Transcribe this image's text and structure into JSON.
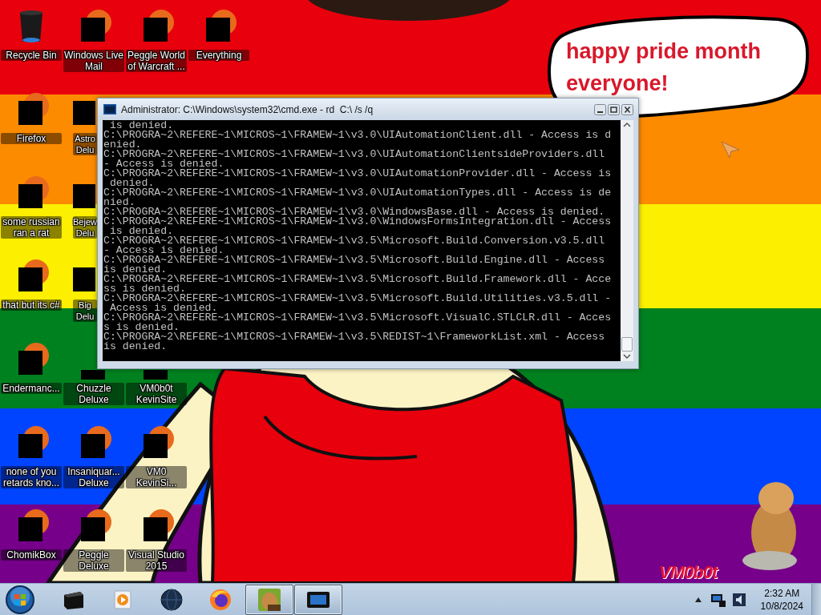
{
  "desktop_rows": [
    [
      {
        "label": "Recycle Bin",
        "kind": "bin"
      },
      {
        "label": "Windows Live Mail",
        "kind": "app"
      },
      {
        "label": "Peggle World of Warcraft ...",
        "kind": "app"
      },
      {
        "label": "Everything",
        "kind": "app"
      }
    ],
    [
      {
        "label": "Firefox",
        "kind": "app"
      },
      {
        "label": "Astro Delu",
        "kind": "partial"
      }
    ],
    [
      {
        "label": "some russian ran a rat",
        "kind": "app"
      },
      {
        "label": "Bejew Delu",
        "kind": "partial"
      }
    ],
    [
      {
        "label": "that but its c#",
        "kind": "app"
      },
      {
        "label": "Big Delu",
        "kind": "partial"
      }
    ],
    [
      {
        "label": "Endermanc...",
        "kind": "app"
      },
      {
        "label": "Chuzzle Deluxe",
        "kind": "clipped"
      },
      {
        "label": "VM0b0t KevinSite",
        "kind": "clipped"
      }
    ],
    [
      {
        "label": "none of you retards kno...",
        "kind": "app"
      },
      {
        "label": "Insaniquar... Deluxe",
        "kind": "app"
      },
      {
        "label": "VM0 KevinSi...",
        "kind": "app"
      }
    ],
    [
      {
        "label": "ChomikBox",
        "kind": "app"
      },
      {
        "label": "Peggle Deluxe",
        "kind": "app"
      },
      {
        "label": "Visual Studio 2015",
        "kind": "app"
      }
    ]
  ],
  "speech_bubble": {
    "text": "happy pride month everyone!"
  },
  "wallpaper_signature": "VM0b0t",
  "console_window": {
    "title": "Administrator: C:\\Windows\\system32\\cmd.exe - rd  C:\\ /s /q",
    "lines": [
      " is denied.",
      "C:\\PROGRA~2\\REFERE~1\\MICROS~1\\FRAMEW~1\\v3.0\\UIAutomationClient.dll - Access is d",
      "enied.",
      "C:\\PROGRA~2\\REFERE~1\\MICROS~1\\FRAMEW~1\\v3.0\\UIAutomationClientsideProviders.dll",
      "- Access is denied.",
      "C:\\PROGRA~2\\REFERE~1\\MICROS~1\\FRAMEW~1\\v3.0\\UIAutomationProvider.dll - Access is",
      " denied.",
      "C:\\PROGRA~2\\REFERE~1\\MICROS~1\\FRAMEW~1\\v3.0\\UIAutomationTypes.dll - Access is de",
      "nied.",
      "C:\\PROGRA~2\\REFERE~1\\MICROS~1\\FRAMEW~1\\v3.0\\WindowsBase.dll - Access is denied.",
      "C:\\PROGRA~2\\REFERE~1\\MICROS~1\\FRAMEW~1\\v3.0\\WindowsFormsIntegration.dll - Access",
      " is denied.",
      "C:\\PROGRA~2\\REFERE~1\\MICROS~1\\FRAMEW~1\\v3.5\\Microsoft.Build.Conversion.v3.5.dll",
      "- Access is denied.",
      "C:\\PROGRA~2\\REFERE~1\\MICROS~1\\FRAMEW~1\\v3.5\\Microsoft.Build.Engine.dll - Access",
      "is denied.",
      "C:\\PROGRA~2\\REFERE~1\\MICROS~1\\FRAMEW~1\\v3.5\\Microsoft.Build.Framework.dll - Acce",
      "ss is denied.",
      "C:\\PROGRA~2\\REFERE~1\\MICROS~1\\FRAMEW~1\\v3.5\\Microsoft.Build.Utilities.v3.5.dll -",
      " Access is denied.",
      "C:\\PROGRA~2\\REFERE~1\\MICROS~1\\FRAMEW~1\\v3.5\\Microsoft.VisualC.STLCLR.dll - Acces",
      "s is denied.",
      "C:\\PROGRA~2\\REFERE~1\\MICROS~1\\FRAMEW~1\\v3.5\\REDIST~1\\FrameworkList.xml - Access",
      "is denied."
    ]
  },
  "taskbar": {
    "items": [
      {
        "kind": "box",
        "open": false
      },
      {
        "kind": "player",
        "open": false
      },
      {
        "kind": "globe",
        "open": false
      },
      {
        "kind": "firefox",
        "open": false
      },
      {
        "kind": "hamster",
        "open": true
      },
      {
        "kind": "console",
        "open": true
      }
    ],
    "clock": {
      "time": "2:32 AM",
      "date": "10/8/2024"
    }
  }
}
